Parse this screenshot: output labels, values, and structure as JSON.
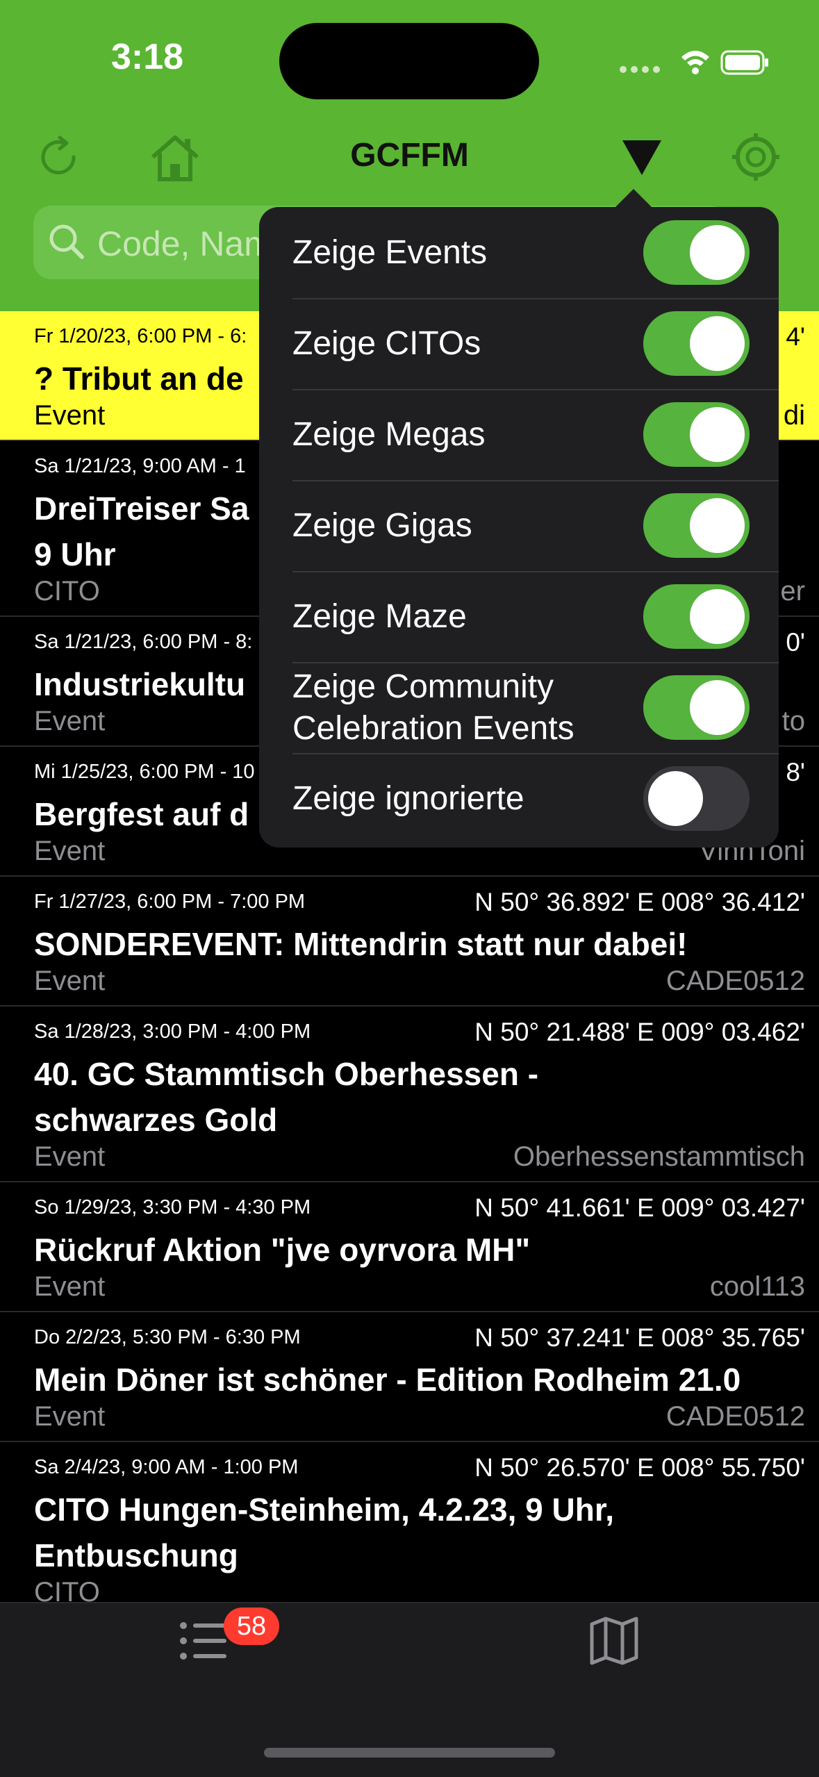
{
  "status": {
    "time": "3:18"
  },
  "header": {
    "title": "GCFFM"
  },
  "search": {
    "placeholder": "Code, Nam"
  },
  "events": [
    {
      "date": "Fr 1/20/23, 6:00 PM - 6:",
      "coord": "4'",
      "title": "? Tribut an de",
      "type": "Event",
      "owner": "di",
      "highlight": true
    },
    {
      "date": "Sa 1/21/23, 9:00 AM - 1",
      "coord": "",
      "title": "DreiTreiser Sa\n9 Uhr",
      "type": "CITO",
      "owner": "er",
      "highlight": false
    },
    {
      "date": "Sa 1/21/23, 6:00 PM - 8:",
      "coord": "0'",
      "title": "Industriekultu",
      "type": "Event",
      "owner": "to",
      "highlight": false
    },
    {
      "date": "Mi 1/25/23, 6:00 PM - 10",
      "coord": "8'",
      "title": "Bergfest auf d",
      "type": "Event",
      "owner": "VinnToni",
      "highlight": false
    },
    {
      "date": "Fr 1/27/23, 6:00 PM - 7:00 PM",
      "coord": "N 50° 36.892' E 008° 36.412'",
      "title": "SONDEREVENT: Mittendrin statt nur dabei!",
      "type": "Event",
      "owner": "CADE0512",
      "highlight": false
    },
    {
      "date": "Sa 1/28/23, 3:00 PM - 4:00 PM",
      "coord": "N 50° 21.488' E 009° 03.462'",
      "title": "40. GC Stammtisch Oberhessen -\nschwarzes Gold",
      "type": "Event",
      "owner": "Oberhessenstammtisch",
      "highlight": false
    },
    {
      "date": "So 1/29/23, 3:30 PM - 4:30 PM",
      "coord": "N 50° 41.661' E 009° 03.427'",
      "title": "Rückruf Aktion \"jve oyrvora MH\"",
      "type": "Event",
      "owner": "cool113",
      "highlight": false
    },
    {
      "date": "Do 2/2/23, 5:30 PM - 6:30 PM",
      "coord": "N 50° 37.241' E 008° 35.765'",
      "title": "Mein Döner ist schöner - Edition Rodheim 21.0",
      "type": "Event",
      "owner": "CADE0512",
      "highlight": false
    },
    {
      "date": "Sa 2/4/23, 9:00 AM - 1:00 PM",
      "coord": "N 50° 26.570' E 008° 55.750'",
      "title": "CITO Hungen-Steinheim, 4.2.23, 9 Uhr,\nEntbuschung",
      "type": "CITO",
      "owner": "",
      "highlight": false
    }
  ],
  "filter_menu": [
    {
      "label": "Zeige Events",
      "on": true
    },
    {
      "label": "Zeige CITOs",
      "on": true
    },
    {
      "label": "Zeige Megas",
      "on": true
    },
    {
      "label": "Zeige Gigas",
      "on": true
    },
    {
      "label": "Zeige Maze",
      "on": true
    },
    {
      "label": "Zeige Community\nCelebration Events",
      "on": true
    },
    {
      "label": "Zeige ignorierte",
      "on": false
    }
  ],
  "tabbar": {
    "list_badge": "58"
  },
  "colors": {
    "header_green": "#5ab532",
    "toggle_on": "#56b33d",
    "highlight": "#ffff33"
  }
}
